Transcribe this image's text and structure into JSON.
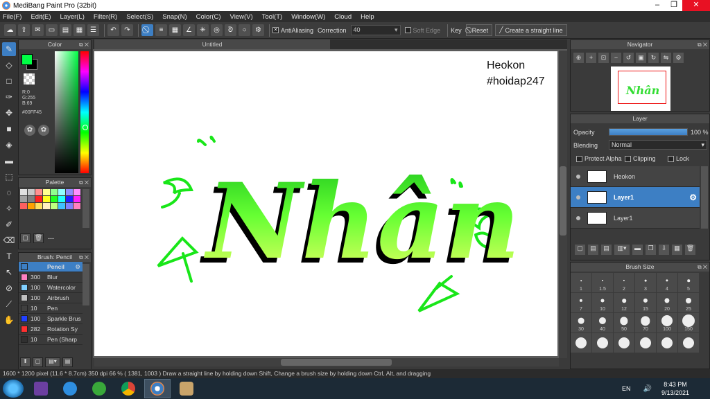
{
  "window": {
    "title": "MediBang Paint Pro (32bit)"
  },
  "menu": [
    "File(F)",
    "Edit(E)",
    "Layer(L)",
    "Filter(R)",
    "Select(S)",
    "Snap(N)",
    "Color(C)",
    "View(V)",
    "Tool(T)",
    "Window(W)",
    "Cloud",
    "Help"
  ],
  "toolbar": {
    "antialiasing_label": "AntiAliasing",
    "correction_label": "Correction",
    "correction_value": "40",
    "soft_edge_label": "Soft Edge",
    "key_label": "Key",
    "reset_label": "Reset",
    "straight_line_label": "Create a straight line"
  },
  "color_panel": {
    "title": "Color",
    "r": "R:0",
    "g": "G:255",
    "b": "B:69",
    "hex": "#00FF45",
    "current_color": "#00ff45"
  },
  "palette_panel": {
    "title": "Palette",
    "colors": [
      "#e0e0e0",
      "#c8c8c8",
      "#ff9090",
      "#ffff90",
      "#90ff90",
      "#90ffff",
      "#9090ff",
      "#ff90ff",
      "#a0a0a0",
      "#808080",
      "#ff2020",
      "#ffff20",
      "#20ff20",
      "#20ffff",
      "#2020ff",
      "#ff20ff",
      "#ff6060",
      "#ffa000",
      "#ffe060",
      "#fff0c0",
      "#c0ff80",
      "#40c0ff",
      "#8080ff",
      "#ff80c0"
    ],
    "footer_text": "---"
  },
  "brush_panel": {
    "title": "Brush: Pencil",
    "brushes": [
      {
        "size": "",
        "name": "Pencil",
        "color": "#3d7fc4",
        "selected": true
      },
      {
        "size": "300",
        "name": "Blur",
        "color": "#ff80c0",
        "selected": false
      },
      {
        "size": "100",
        "name": "Watercolor",
        "color": "#80d0ff",
        "selected": false
      },
      {
        "size": "100",
        "name": "Airbrush",
        "color": "#c0c0c0",
        "selected": false
      },
      {
        "size": "10",
        "name": "Pen",
        "color": "#404040",
        "selected": false
      },
      {
        "size": "100",
        "name": "Sparkle Brus",
        "color": "#2040ff",
        "selected": false
      },
      {
        "size": "282",
        "name": "Rotation Sy",
        "color": "#ff3030",
        "selected": false
      },
      {
        "size": "10",
        "name": "Pen (Sharp",
        "color": "#303030",
        "selected": false
      }
    ]
  },
  "canvas": {
    "tab_title": "Untitled",
    "text_line1": "Heokon",
    "text_line2": "#hoidap247",
    "artwork_text": "Nhân"
  },
  "navigator": {
    "title": "Navigator"
  },
  "layer_panel": {
    "title": "Layer",
    "opacity_label": "Opacity",
    "opacity_value": "100 %",
    "opacity_fraction": 1.0,
    "blending_label": "Blending",
    "blending_value": "Normal",
    "protect_alpha_label": "Protect Alpha",
    "clipping_label": "Clipping",
    "lock_label": "Lock",
    "layers": [
      {
        "name": "Heokon",
        "selected": false
      },
      {
        "name": "Layer1",
        "selected": true
      },
      {
        "name": "Layer1",
        "selected": false
      }
    ]
  },
  "brush_size_panel": {
    "title": "Brush Size",
    "sizes": [
      "1",
      "1.5",
      "2",
      "3",
      "4",
      "5",
      "7",
      "10",
      "12",
      "15",
      "20",
      "25",
      "30",
      "40",
      "50",
      "70",
      "100",
      "150",
      "",
      "",
      "",
      "",
      "",
      ""
    ]
  },
  "status": {
    "dimensions": "1600 * 1200 pixel",
    "physical": "(11.6 * 8.7cm)",
    "dpi": "350 dpi",
    "zoom": "66 %",
    "coords": "( 1381, 1003 )",
    "hint": "Draw a straight line by holding down Shift, Change a brush size by holding down Ctrl, Alt, and dragging"
  },
  "taskbar": {
    "lang": "EN",
    "time": "8:43 PM",
    "date": "9/13/2021"
  }
}
